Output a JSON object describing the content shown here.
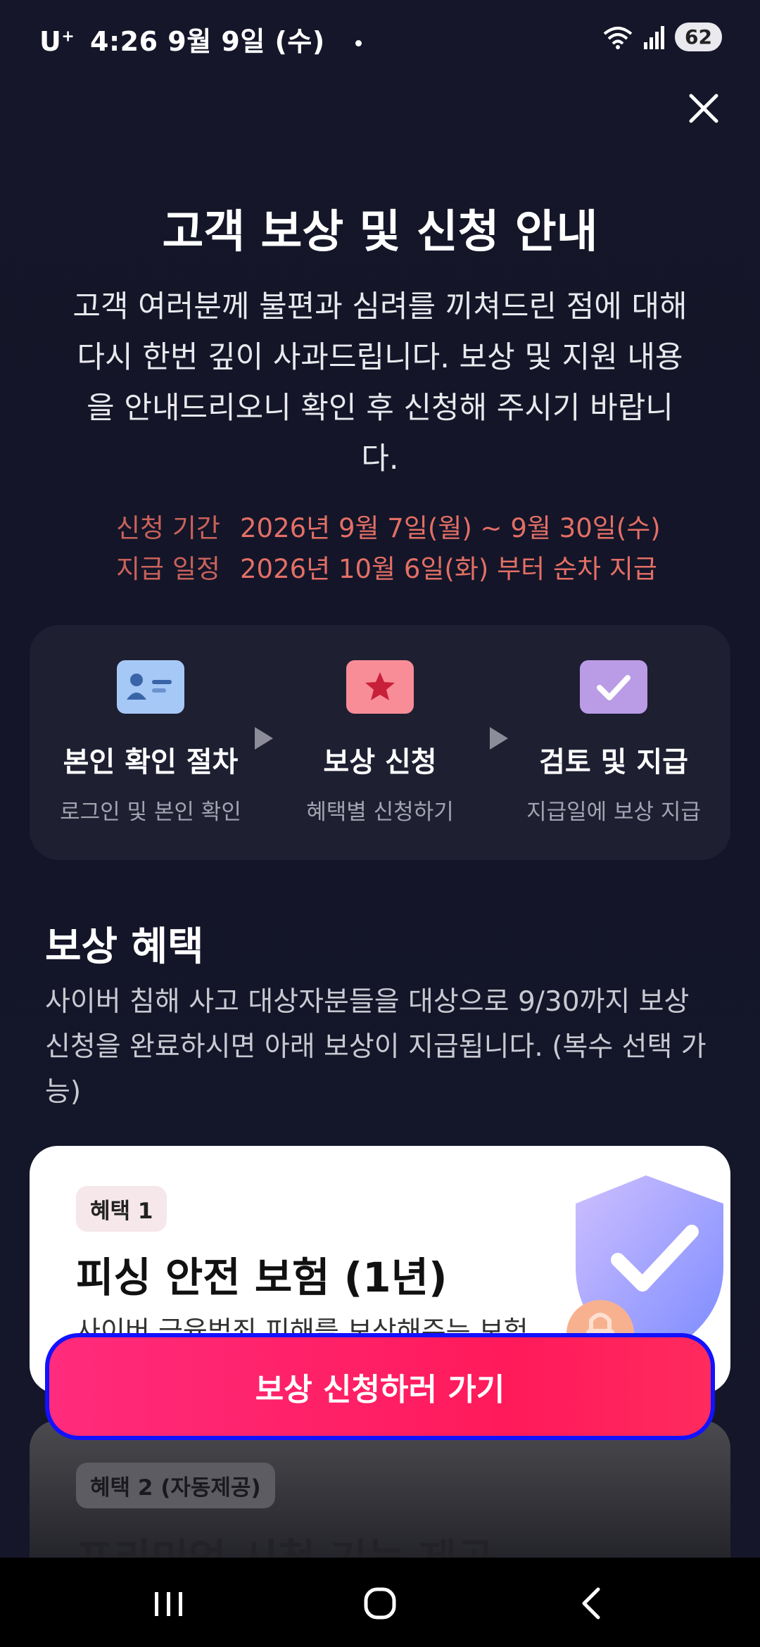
{
  "status_bar": {
    "carrier": "U",
    "carrier_sup": "+",
    "time_date": "4:26  9월 9일 (수)",
    "battery": "62"
  },
  "header": {
    "title": "고객 보상 및 신청 안내",
    "intro": "고객 여러분께 불편과 심려를 끼쳐드린 점에 대해 다시 한번 깊이 사과드립니다. 보상 및 지원 내용을 안내드리오니 확인 후 신청해 주시기 바랍니다."
  },
  "period": {
    "apply_label": "신청 기간",
    "apply_value": "2026년 9월 7일(월) ~ 9월 30일(수)",
    "pay_label": "지급 일정",
    "pay_value": "2026년 10월 6일(화) 부터 순차 지급"
  },
  "steps": [
    {
      "name": "본인 확인 절차",
      "desc": "로그인 및 본인 확인",
      "icon": "id-card-icon"
    },
    {
      "name": "보상 신청",
      "desc": "혜택별 신청하기",
      "icon": "star-ticket-icon"
    },
    {
      "name": "검토 및 지급",
      "desc": "지급일에 보상 지급",
      "icon": "check-icon"
    }
  ],
  "benefits": {
    "title": "보상 혜택",
    "desc": "사이버 침해 사고 대상자분들을 대상으로 9/30까지 보상 신청을 완료하시면 아래 보상이 지급됩니다. (복수 선택 가능)",
    "cards": [
      {
        "badge": "혜택 1",
        "title": "피싱 안전 보험 (1년)",
        "desc": "사이버 금융범죄 피해를 보상해주는 보험"
      },
      {
        "badge": "혜택 2 (자동제공)",
        "title": "프리미엄 시청 기능 제공"
      }
    ]
  },
  "cta": {
    "label": "보상 신청하러 가기"
  },
  "colors": {
    "accent": "#ff1f66",
    "period_text": "#e36f66",
    "background": "#15162a"
  }
}
